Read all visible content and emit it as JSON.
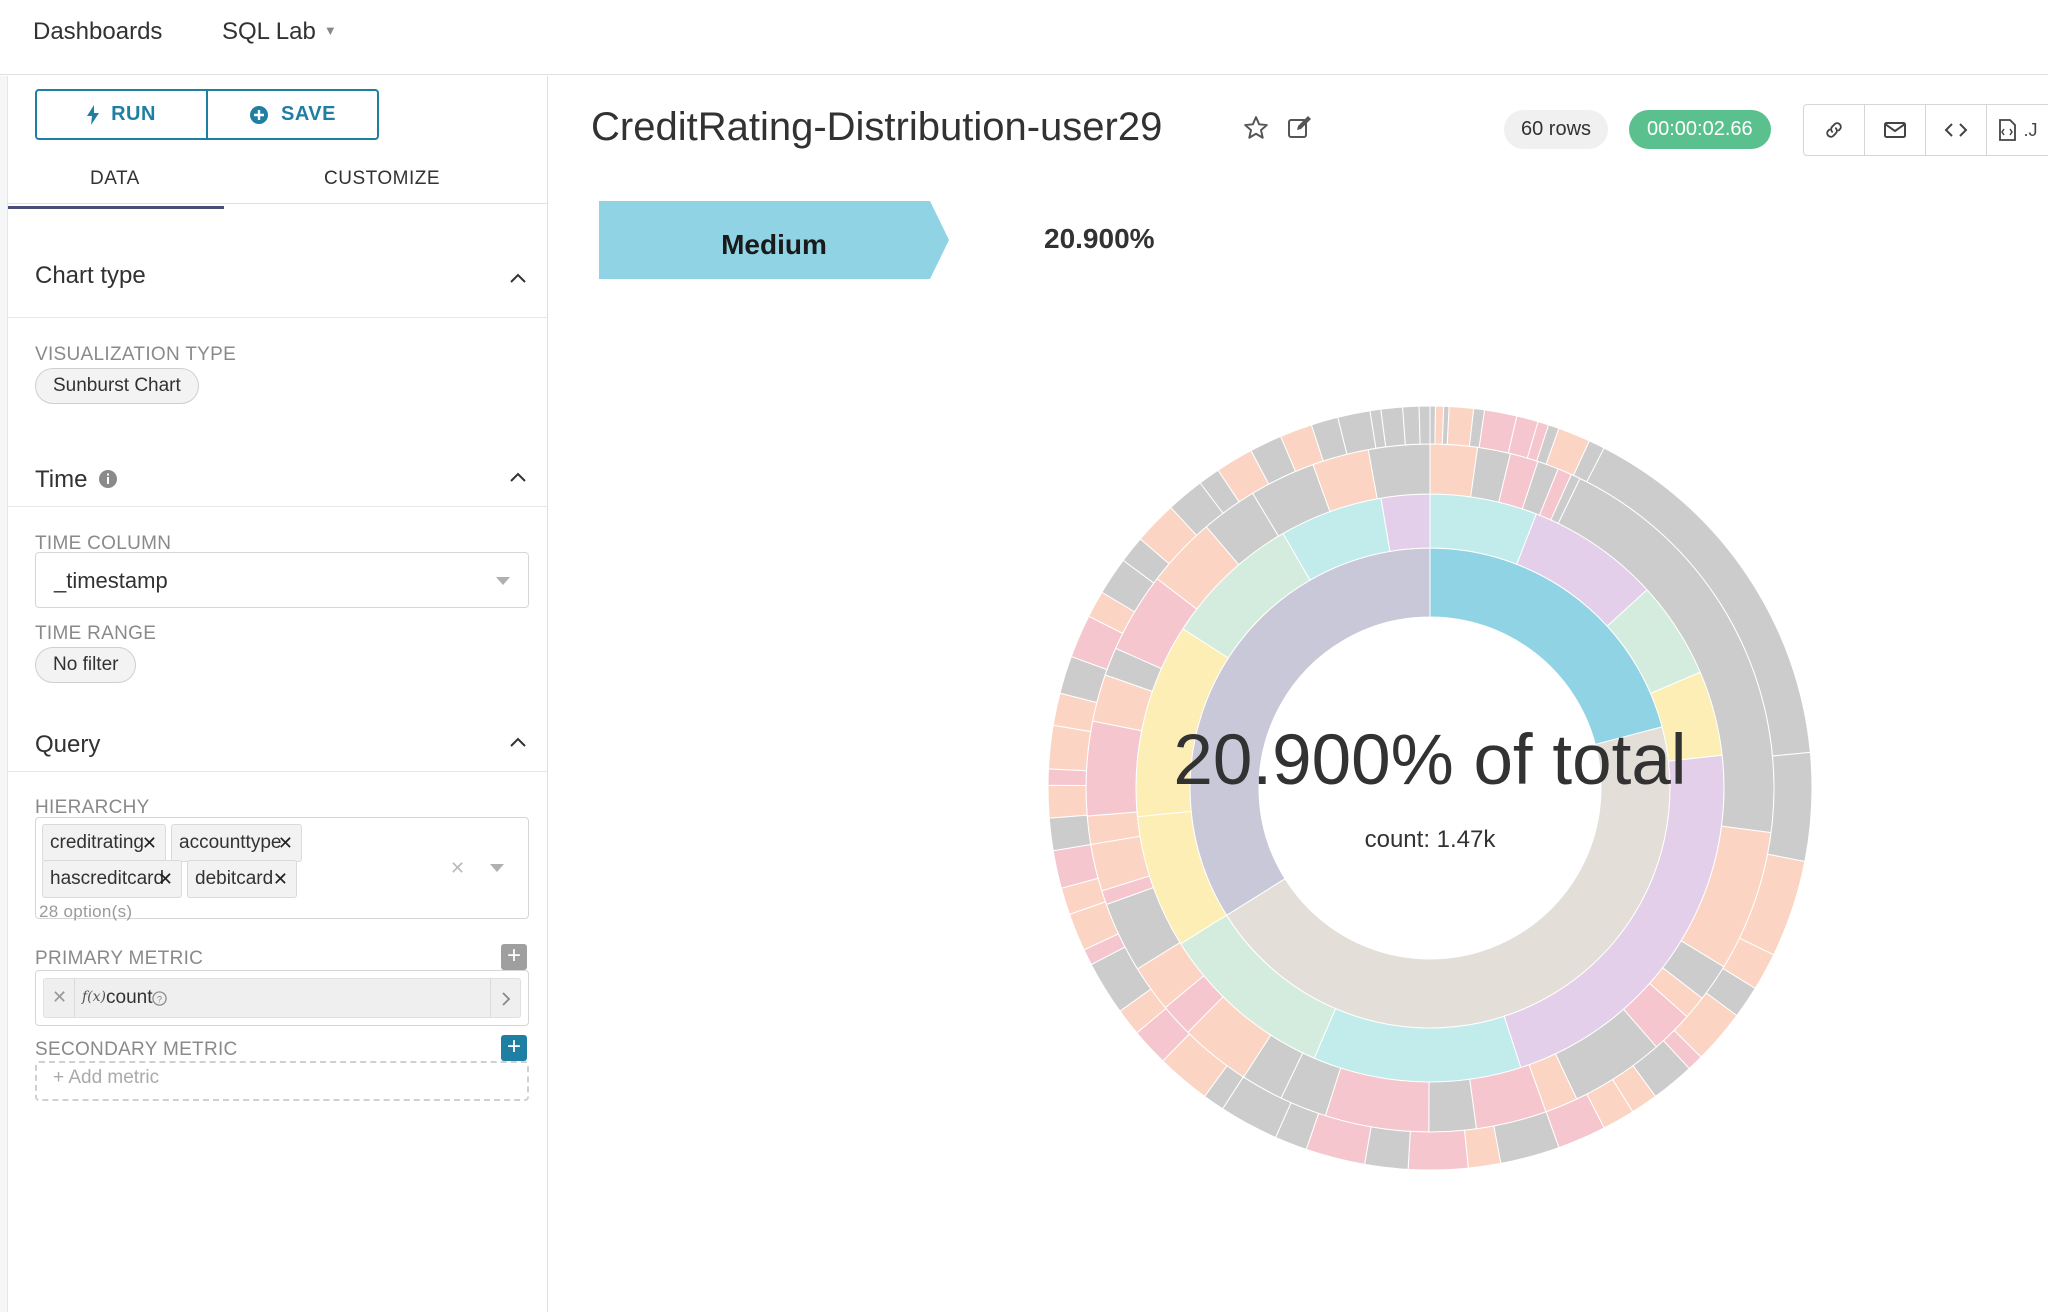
{
  "nav": {
    "dashboards": "Dashboards",
    "sql_lab": "SQL Lab"
  },
  "toolbar": {
    "run_label": "RUN",
    "save_label": "SAVE"
  },
  "tabs": {
    "data": "DATA",
    "customize": "CUSTOMIZE"
  },
  "sections": {
    "chart_type": {
      "title": "Chart type",
      "visualization_type_label": "VISUALIZATION TYPE",
      "visualization_type_value": "Sunburst Chart"
    },
    "time": {
      "title": "Time",
      "time_column_label": "TIME COLUMN",
      "time_column_value": "_timestamp",
      "time_range_label": "TIME RANGE",
      "time_range_value": "No filter"
    },
    "query": {
      "title": "Query",
      "hierarchy_label": "HIERARCHY",
      "hierarchy_tags": [
        "creditrating",
        "accounttype",
        "hascreditcard",
        "debitcard"
      ],
      "options_count": "28 option(s)",
      "primary_metric_label": "PRIMARY METRIC",
      "primary_metric_fx": "f(x)",
      "primary_metric_value": "count",
      "secondary_metric_label": "SECONDARY METRIC",
      "add_metric_placeholder": "+ Add metric"
    }
  },
  "chart_header": {
    "title": "CreditRating-Distribution-user29",
    "rows_badge": "60 rows",
    "time_badge": "00:00:02.66",
    "action_icons": [
      "link-icon",
      "mail-icon",
      "code-icon",
      "file-json-icon"
    ]
  },
  "colors": {
    "accent": "#1f7fa3",
    "success": "#5ac18e",
    "tab_underline": "#484f7c"
  },
  "chart_data": {
    "type": "sunburst",
    "breadcrumb": {
      "label": "Medium",
      "percent": "20.900%"
    },
    "center": {
      "main": "20.900% of total",
      "sub": "count: 1.47k"
    },
    "levels": [
      "creditrating",
      "accounttype",
      "hascreditcard",
      "debitcard"
    ],
    "ring1": [
      {
        "value": 0.209,
        "color": "#8fd3e4"
      },
      {
        "value": 0.452,
        "color": "#e4ded8"
      },
      {
        "value": 0.339,
        "color": "#c8c8d9"
      }
    ],
    "ring2": [
      {
        "value": 0.053,
        "color": "#c2ecec"
      },
      {
        "value": 0.066,
        "color": "#e3cfe9"
      },
      {
        "value": 0.048,
        "color": "#d4ecdd"
      },
      {
        "value": 0.042,
        "color": "#fceeb5"
      },
      {
        "value": 0.196,
        "color": "#e3cfe9"
      },
      {
        "value": 0.103,
        "color": "#c2ecec"
      },
      {
        "value": 0.087,
        "color": "#d4ecdd"
      },
      {
        "value": 0.066,
        "color": "#fceeb5"
      },
      {
        "value": 0.096,
        "color": "#fceeb5"
      },
      {
        "value": 0.068,
        "color": "#d4ecdd"
      },
      {
        "value": 0.051,
        "color": "#c2ecec"
      },
      {
        "value": 0.024,
        "color": "#e3cfe9"
      }
    ],
    "ring3": [
      {
        "value": 0.02,
        "color": "#fbd4c3"
      },
      {
        "value": 0.014,
        "color": "#cccccc"
      },
      {
        "value": 0.012,
        "color": "#f5c6ce"
      },
      {
        "value": 0.009,
        "color": "#cccccc"
      },
      {
        "value": 0.006,
        "color": "#f5c6ce"
      },
      {
        "value": 0.004,
        "color": "#cccccc"
      },
      {
        "value": 0.18,
        "color": "#cccccc"
      },
      {
        "value": 0.06,
        "color": "#fbd4c3"
      },
      {
        "value": 0.016,
        "color": "#cccccc"
      },
      {
        "value": 0.01,
        "color": "#fbd4c3"
      },
      {
        "value": 0.018,
        "color": "#f5c6ce"
      },
      {
        "value": 0.04,
        "color": "#cccccc"
      },
      {
        "value": 0.014,
        "color": "#fbd4c3"
      },
      {
        "value": 0.03,
        "color": "#f5c6ce"
      },
      {
        "value": 0.02,
        "color": "#cccccc"
      },
      {
        "value": 0.044,
        "color": "#f5c6ce"
      },
      {
        "value": 0.02,
        "color": "#cccccc"
      },
      {
        "value": 0.018,
        "color": "#cccccc"
      },
      {
        "value": 0.03,
        "color": "#fbd4c3"
      },
      {
        "value": 0.014,
        "color": "#f5c6ce"
      },
      {
        "value": 0.02,
        "color": "#fbd4c3"
      },
      {
        "value": 0.03,
        "color": "#cccccc"
      },
      {
        "value": 0.006,
        "color": "#f5c6ce"
      },
      {
        "value": 0.02,
        "color": "#fbd4c3"
      },
      {
        "value": 0.012,
        "color": "#fbd4c3"
      },
      {
        "value": 0.04,
        "color": "#f5c6ce"
      },
      {
        "value": 0.02,
        "color": "#fbd4c3"
      },
      {
        "value": 0.012,
        "color": "#cccccc"
      },
      {
        "value": 0.034,
        "color": "#f5c6ce"
      },
      {
        "value": 0.03,
        "color": "#fbd4c3"
      },
      {
        "value": 0.024,
        "color": "#cccccc"
      },
      {
        "value": 0.028,
        "color": "#cccccc"
      },
      {
        "value": 0.024,
        "color": "#fbd4c3"
      },
      {
        "value": 0.026,
        "color": "#cccccc"
      }
    ],
    "ring4": [
      {
        "value": 0.002,
        "color": "#cccccc"
      },
      {
        "value": 0.003,
        "color": "#fbd4c3"
      },
      {
        "value": 0.002,
        "color": "#cccccc"
      },
      {
        "value": 0.009,
        "color": "#fbd4c3"
      },
      {
        "value": 0.004,
        "color": "#cccccc"
      },
      {
        "value": 0.012,
        "color": "#f5c6ce"
      },
      {
        "value": 0.008,
        "color": "#f5c6ce"
      },
      {
        "value": 0.004,
        "color": "#f5c6ce"
      },
      {
        "value": 0.004,
        "color": "#cccccc"
      },
      {
        "value": 0.012,
        "color": "#fbd4c3"
      },
      {
        "value": 0.006,
        "color": "#cccccc"
      },
      {
        "value": 0.14,
        "color": "#cccccc"
      },
      {
        "value": 0.04,
        "color": "#cccccc"
      },
      {
        "value": 0.036,
        "color": "#fbd4c3"
      },
      {
        "value": 0.014,
        "color": "#fbd4c3"
      },
      {
        "value": 0.012,
        "color": "#cccccc"
      },
      {
        "value": 0.02,
        "color": "#fbd4c3"
      },
      {
        "value": 0.006,
        "color": "#f5c6ce"
      },
      {
        "value": 0.016,
        "color": "#cccccc"
      },
      {
        "value": 0.01,
        "color": "#fbd4c3"
      },
      {
        "value": 0.012,
        "color": "#fbd4c3"
      },
      {
        "value": 0.018,
        "color": "#f5c6ce"
      },
      {
        "value": 0.022,
        "color": "#cccccc"
      },
      {
        "value": 0.012,
        "color": "#fbd4c3"
      },
      {
        "value": 0.022,
        "color": "#f5c6ce"
      },
      {
        "value": 0.016,
        "color": "#cccccc"
      },
      {
        "value": 0.022,
        "color": "#f5c6ce"
      },
      {
        "value": 0.012,
        "color": "#cccccc"
      },
      {
        "value": 0.022,
        "color": "#cccccc"
      },
      {
        "value": 0.008,
        "color": "#cccccc"
      },
      {
        "value": 0.02,
        "color": "#fbd4c3"
      },
      {
        "value": 0.014,
        "color": "#f5c6ce"
      },
      {
        "value": 0.01,
        "color": "#fbd4c3"
      },
      {
        "value": 0.02,
        "color": "#cccccc"
      },
      {
        "value": 0.006,
        "color": "#f5c6ce"
      },
      {
        "value": 0.014,
        "color": "#fbd4c3"
      },
      {
        "value": 0.01,
        "color": "#fbd4c3"
      },
      {
        "value": 0.014,
        "color": "#f5c6ce"
      },
      {
        "value": 0.012,
        "color": "#cccccc"
      },
      {
        "value": 0.012,
        "color": "#fbd4c3"
      },
      {
        "value": 0.006,
        "color": "#f5c6ce"
      },
      {
        "value": 0.016,
        "color": "#fbd4c3"
      },
      {
        "value": 0.012,
        "color": "#fbd4c3"
      },
      {
        "value": 0.014,
        "color": "#cccccc"
      },
      {
        "value": 0.016,
        "color": "#f5c6ce"
      },
      {
        "value": 0.01,
        "color": "#fbd4c3"
      },
      {
        "value": 0.014,
        "color": "#cccccc"
      },
      {
        "value": 0.01,
        "color": "#cccccc"
      },
      {
        "value": 0.016,
        "color": "#fbd4c3"
      },
      {
        "value": 0.014,
        "color": "#cccccc"
      },
      {
        "value": 0.008,
        "color": "#cccccc"
      },
      {
        "value": 0.014,
        "color": "#fbd4c3"
      },
      {
        "value": 0.012,
        "color": "#cccccc"
      },
      {
        "value": 0.012,
        "color": "#fbd4c3"
      },
      {
        "value": 0.01,
        "color": "#cccccc"
      },
      {
        "value": 0.012,
        "color": "#cccccc"
      },
      {
        "value": 0.004,
        "color": "#cccccc"
      },
      {
        "value": 0.008,
        "color": "#cccccc"
      },
      {
        "value": 0.006,
        "color": "#cccccc"
      },
      {
        "value": 0.004,
        "color": "#cccccc"
      }
    ]
  }
}
